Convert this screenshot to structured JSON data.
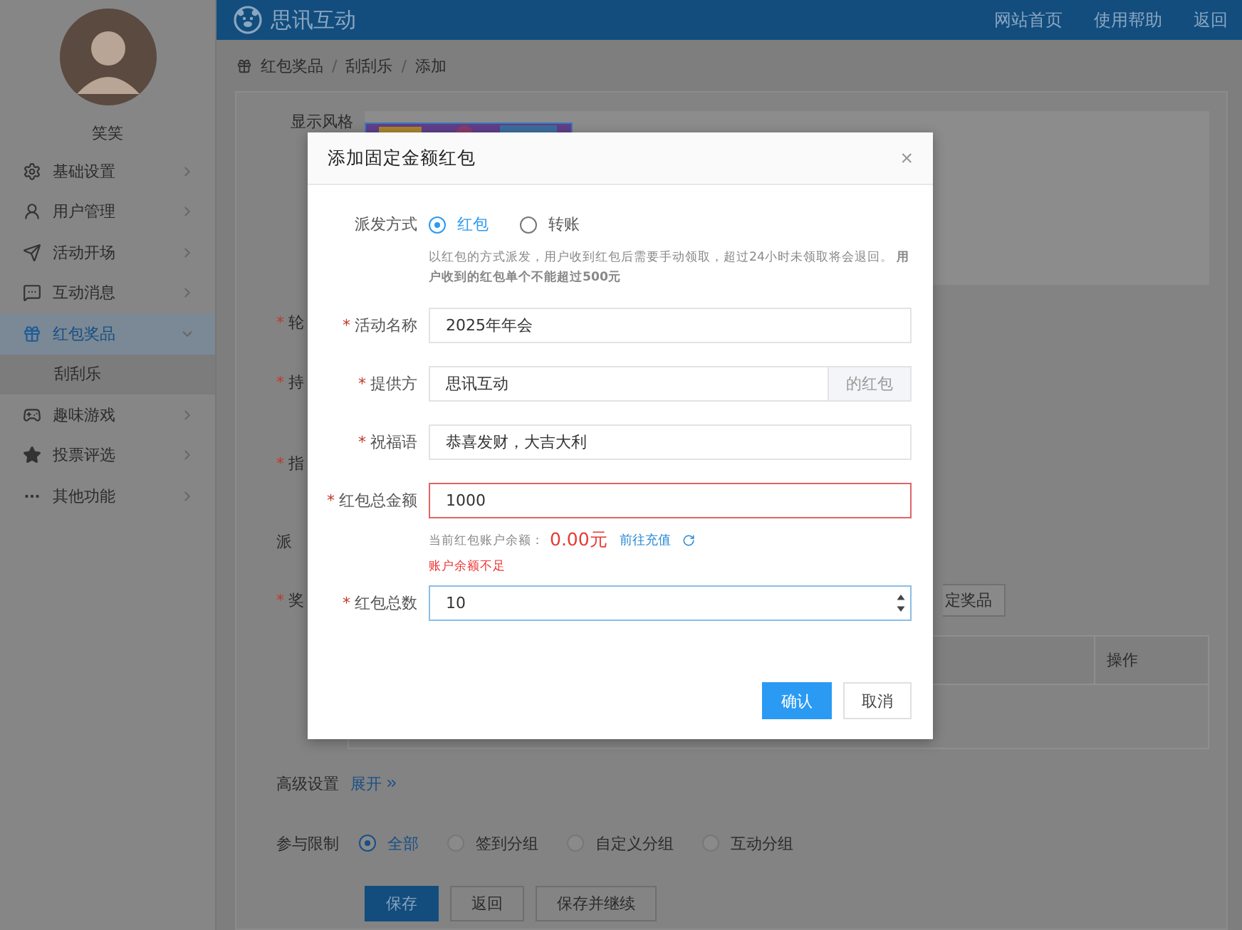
{
  "sidebar": {
    "user_name": "笑笑",
    "items": [
      {
        "label": "基础设置",
        "selected": false,
        "expanded": false
      },
      {
        "label": "用户管理",
        "selected": false,
        "expanded": false
      },
      {
        "label": "活动开场",
        "selected": false,
        "expanded": false
      },
      {
        "label": "互动消息",
        "selected": false,
        "expanded": false
      },
      {
        "label": "红包奖品",
        "selected": true,
        "expanded": true,
        "children": [
          {
            "label": "刮刮乐",
            "selected": true
          }
        ]
      },
      {
        "label": "趣味游戏",
        "selected": false,
        "expanded": false
      },
      {
        "label": "投票评选",
        "selected": false,
        "expanded": false
      },
      {
        "label": "其他功能",
        "selected": false,
        "expanded": false
      }
    ]
  },
  "header": {
    "brand": "思讯互动",
    "links": [
      "网站首页",
      "使用帮助",
      "返回"
    ]
  },
  "breadcrumb": {
    "separator": "/",
    "items": [
      "红包奖品",
      "刮刮乐",
      "添加"
    ]
  },
  "form": {
    "style_label": "显示风格",
    "cut_labels": [
      {
        "text": "轮",
        "mark": "*"
      },
      {
        "text": "持",
        "mark": "*"
      },
      {
        "text": "指",
        "mark": "*"
      },
      {
        "text": "派"
      },
      {
        "text": "奖",
        "mark": "*"
      }
    ],
    "prize_button": "定奖品",
    "table_columns": [
      "操作"
    ],
    "advanced": {
      "label": "高级设置",
      "link": "展开"
    },
    "participation": {
      "label": "参与限制",
      "options": [
        {
          "label": "全部",
          "selected": true
        },
        {
          "label": "签到分组",
          "selected": false
        },
        {
          "label": "自定义分组",
          "selected": false
        },
        {
          "label": "互动分组",
          "selected": false
        }
      ]
    },
    "buttons": [
      {
        "label": "保存",
        "kind": "primary"
      },
      {
        "label": "返回",
        "kind": "default"
      },
      {
        "label": "保存并继续",
        "kind": "default"
      }
    ]
  },
  "modal": {
    "title": "添加固定金额红包",
    "close": "×",
    "method": {
      "label": "派发方式",
      "options": [
        {
          "label": "红包",
          "selected": true
        },
        {
          "label": "转账",
          "selected": false
        }
      ]
    },
    "note": "以红包的方式派发，用户收到红包后需要手动领取，超过24小时未领取将会退回。 **用户收到的红包单个不能超过500元**",
    "fields": [
      {
        "label": "活动名称",
        "mark": "*",
        "value": "2025年年会",
        "kind": "text",
        "error": false,
        "focused": false
      },
      {
        "label": "提供方",
        "mark": "*",
        "value": "思讯互动",
        "suffix": "的红包",
        "kind": "text",
        "error": false,
        "focused": false
      },
      {
        "label": "祝福语",
        "mark": "*",
        "value": "恭喜发财，大吉大利",
        "kind": "text",
        "error": false,
        "focused": false
      },
      {
        "label": "红包总金额",
        "mark": "*",
        "value": "1000",
        "kind": "text",
        "error": true,
        "focused": false,
        "balance": {
          "label": "当前红包账户余额：",
          "amount": "0.00元",
          "link": "前往充值",
          "message": "账户余额不足"
        }
      },
      {
        "label": "红包总数",
        "mark": "*",
        "value": "10",
        "kind": "number",
        "error": false,
        "focused": true
      }
    ],
    "buttons": [
      {
        "label": "确认",
        "kind": "primary"
      },
      {
        "label": "取消",
        "kind": "default"
      }
    ]
  }
}
